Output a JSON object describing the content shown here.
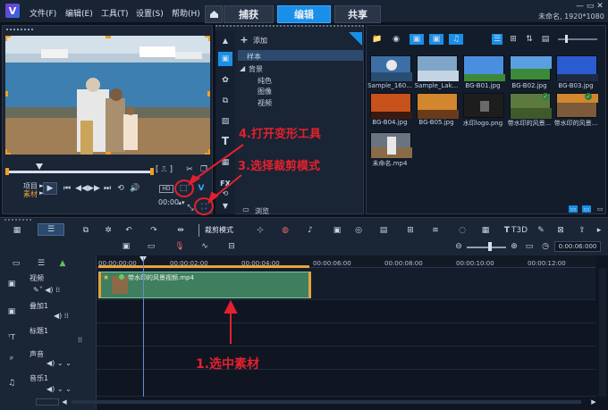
{
  "menu": [
    "文件(F)",
    "编辑(E)",
    "工具(T)",
    "设置(S)",
    "帮助(H)"
  ],
  "tabs": [
    {
      "label": "捕获",
      "active": false
    },
    {
      "label": "编辑",
      "active": true
    },
    {
      "label": "共享",
      "active": false
    }
  ],
  "project_info": "未命名, 1920*1080",
  "player": {
    "project_label": "项目",
    "clip_label": "素材",
    "timecode": "00:00"
  },
  "library": {
    "add_label": "添加",
    "tree": [
      "样本",
      "背景",
      "纯色",
      "图像",
      "视频"
    ],
    "browse_label": "浏览"
  },
  "thumbnails": [
    {
      "label": "Sample_160...",
      "color": "#3b6fa6"
    },
    {
      "label": "Sample_Lak...",
      "color": "#7fa6c8"
    },
    {
      "label": "BG-B01.jpg",
      "color": "#4a8ee0"
    },
    {
      "label": "BG-B02.jpg",
      "color": "#3b8a3a"
    },
    {
      "label": "BG-B03.jpg",
      "color": "#2b5bd1"
    },
    {
      "label": "BG-B04.jpg",
      "color": "#c8521c"
    },
    {
      "label": "BG-B05.jpg",
      "color": "#d2862e"
    },
    {
      "label": "水印logo.png",
      "color": "#1d1d1d"
    },
    {
      "label": "带水印的风景...",
      "color": "#5d7a3e"
    },
    {
      "label": "带水印的风景...",
      "color": "#7c5a3a"
    },
    {
      "label": "未命名.mp4",
      "color": "#6a7480"
    }
  ],
  "timeline": {
    "crop_mode_label": "裁剪模式",
    "duration": "0:00:06:000",
    "ticks": [
      "00:00:00:00",
      "00:00:02:00",
      "00:00:04:00",
      "00:00:06:00",
      "00:00:08:00",
      "00:00:10:00",
      "00:00:12:00"
    ],
    "tracks": [
      "视频",
      "叠加1",
      "标题1",
      "声音",
      "音乐1"
    ],
    "clip_name": "带水印的风景视频.mp4"
  },
  "annotations": {
    "step1": "1.选中素材",
    "step3": "3.选择裁剪模式",
    "step4": "4.打开变形工具"
  }
}
